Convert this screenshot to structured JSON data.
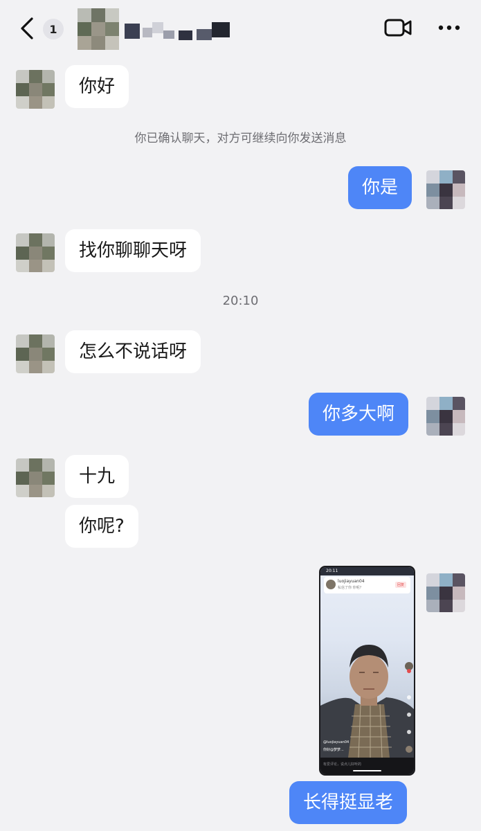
{
  "header": {
    "unread_count": "1",
    "icons": {
      "back": "chevron-left-icon",
      "video": "video-camera-icon",
      "more": "more-dots-icon"
    }
  },
  "messages": {
    "m1": "你好",
    "system_notice": "你已确认聊天，对方可继续向你发送消息",
    "m2": "你是",
    "m3": "找你聊聊天呀",
    "time_divider": "20:10",
    "m4": "怎么不说话呀",
    "m5": "你多大啊",
    "m6": "十九",
    "m7": "你呢?",
    "m8": "长得挺显老"
  },
  "shared_screenshot": {
    "status_time": "20:11",
    "account": "luojiayuan04",
    "subline": "私信了你 你呢?",
    "tag": "回复",
    "caption_user": "@luojiayuan04",
    "caption_line": "你好@梦梦...",
    "comment_hint": "有爱评论，说点儿好听的"
  },
  "colors": {
    "background": "#f2f2f4",
    "outgoing_bubble": "#4e86f7",
    "incoming_bubble": "#ffffff",
    "meta_text": "#6d6d72"
  }
}
